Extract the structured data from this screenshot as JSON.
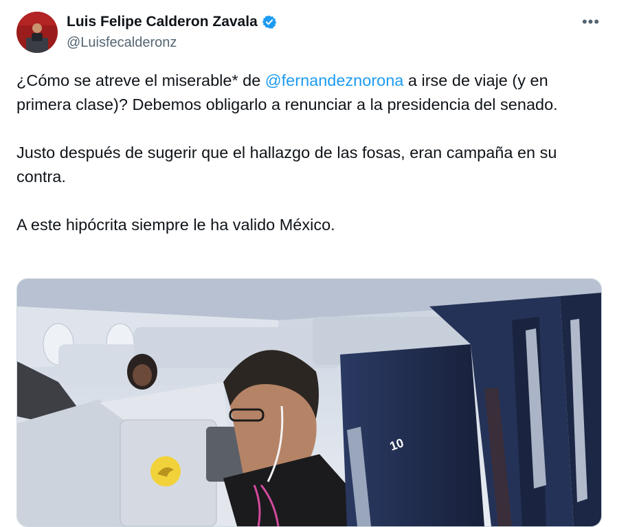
{
  "author": {
    "display_name": "Luis Felipe Calderon Zavala",
    "handle": "@Luisfecalderonz",
    "verified_icon": "verified-badge-icon",
    "avatar_icon": "profile-photo"
  },
  "menu": {
    "more_label": "•••"
  },
  "body": {
    "line1_before": "¿Cómo se atreve el miserable* de ",
    "mention": "@fernandeznorona",
    "line1_after": " a irse de viaje (y en primera clase)? Debemos obligarlo a renunciar a la presidencia del senado.",
    "paragraph2": "Justo después de sugerir que el hallazgo de las fosas, eran campaña en su contra.",
    "paragraph3": "A este hipócrita siempre le ha valido México."
  },
  "media": {
    "seat_label": "10",
    "colors": {
      "cabin": "#dfe4ec",
      "seat_navy": "#1f2a4a",
      "accent": "#1d9bf0",
      "logo_yellow": "#f2d23a"
    }
  }
}
